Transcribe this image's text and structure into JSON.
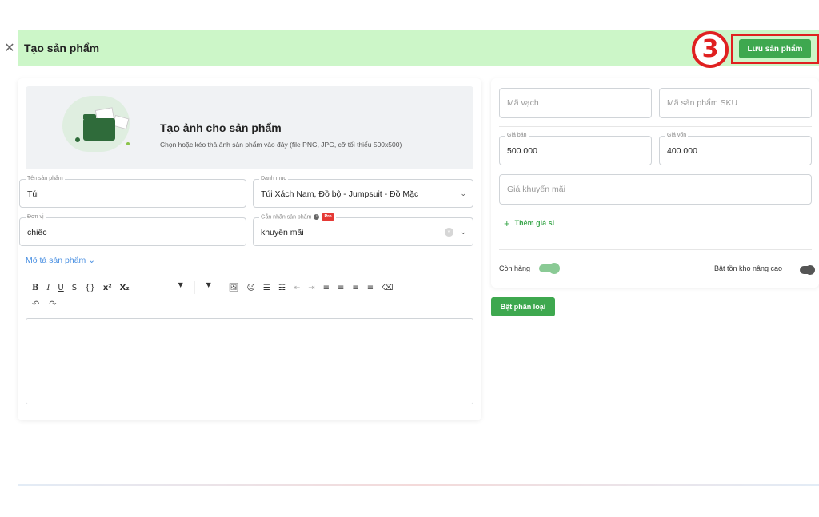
{
  "header": {
    "close_icon": "close-icon",
    "title": "Tạo sản phẩm",
    "step_number": "3",
    "save_label": "Lưu sản phẩm"
  },
  "upload": {
    "title": "Tạo ảnh cho sản phẩm",
    "subtitle": "Chọn hoặc kéo thả ảnh sản phẩm vào đây (file PNG, JPG, cỡ tối thiểu 500x500)"
  },
  "form": {
    "product_name": {
      "label": "Tên sản phẩm",
      "value": "Túi"
    },
    "category": {
      "label": "Danh mục",
      "value": "Túi Xách Nam, Đồ bộ - Jumpsuit - Đồ Mặc"
    },
    "unit": {
      "label": "Đơn vị",
      "value": "chiếc"
    },
    "tag": {
      "label": "Gắn nhãn sản phẩm",
      "pro_badge": "Pro",
      "value": "khuyến mãi"
    },
    "description_link": "Mô tả sản phẩm"
  },
  "toolbar": {
    "bold": "B",
    "italic": "I",
    "underline": "U",
    "strike": "S",
    "code": "{}",
    "superscript": "x²",
    "subscript": "X₂",
    "undo": "↶",
    "redo": "↷"
  },
  "right": {
    "barcode": {
      "placeholder": "Mã vạch"
    },
    "sku": {
      "placeholder": "Mã sản phẩm SKU"
    },
    "sell_price": {
      "label": "Giá bán",
      "value": "500.000"
    },
    "cost_price": {
      "label": "Giá vốn",
      "value": "400.000"
    },
    "promo_price": {
      "placeholder": "Giá khuyến mãi"
    },
    "add_wholesale": "Thêm giá sỉ",
    "in_stock_label": "Còn hàng",
    "in_stock_on": true,
    "advanced_stock_label": "Bật tồn kho nâng cao",
    "advanced_stock_on": false
  },
  "variant_button": "Bật phân loại",
  "colors": {
    "header_bg": "#ccf6c8",
    "accent_green": "#3ea84f",
    "highlight_red": "#e02020",
    "link_blue": "#4a90e2"
  }
}
